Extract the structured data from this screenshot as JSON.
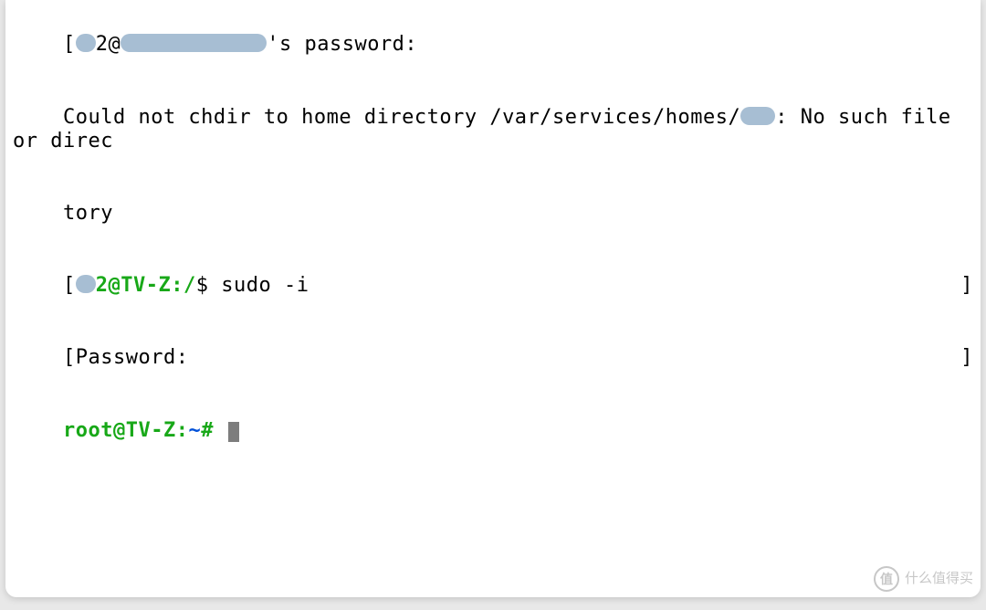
{
  "terminal": {
    "lines": {
      "l1_prefix": "[",
      "l1_mid": "2@",
      "l1_suffix": "'s password:",
      "l2": "Could not chdir to home directory /var/services/homes/",
      "l2_suffix": ": No such file or direc",
      "l3": "tory",
      "l4_prefix": "[",
      "l4_user": "2@TV-Z",
      "l4_path": ":/",
      "l4_dollar": "$ ",
      "l4_cmd": "sudo -i",
      "l5_prefix": "[",
      "l5_text": "Password:",
      "l6_user": "root@TV-Z",
      "l6_path": ":",
      "l6_tilde": "~",
      "l6_hash": "# "
    }
  },
  "watermark": {
    "icon_text": "值",
    "text": "什么值得买"
  },
  "colors": {
    "prompt_green": "#18a818",
    "prompt_blue": "#0050d8",
    "redact": "#a7bed3"
  }
}
